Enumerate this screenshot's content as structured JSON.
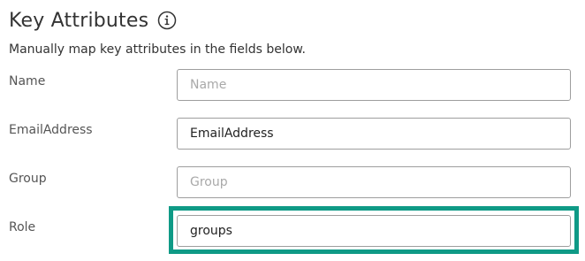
{
  "section": {
    "title": "Key Attributes",
    "info_icon": "info-circle-icon",
    "description": "Manually map key attributes in the fields below."
  },
  "fields": [
    {
      "label": "Name",
      "value": "",
      "placeholder": "Name"
    },
    {
      "label": "EmailAddress",
      "value": "EmailAddress",
      "placeholder": ""
    },
    {
      "label": "Group",
      "value": "",
      "placeholder": "Group"
    },
    {
      "label": "Role",
      "value": "groups",
      "placeholder": ""
    }
  ],
  "colors": {
    "highlight": "#0f9a86",
    "input_border": "#9e9e9e",
    "placeholder": "#a9a9a9"
  }
}
